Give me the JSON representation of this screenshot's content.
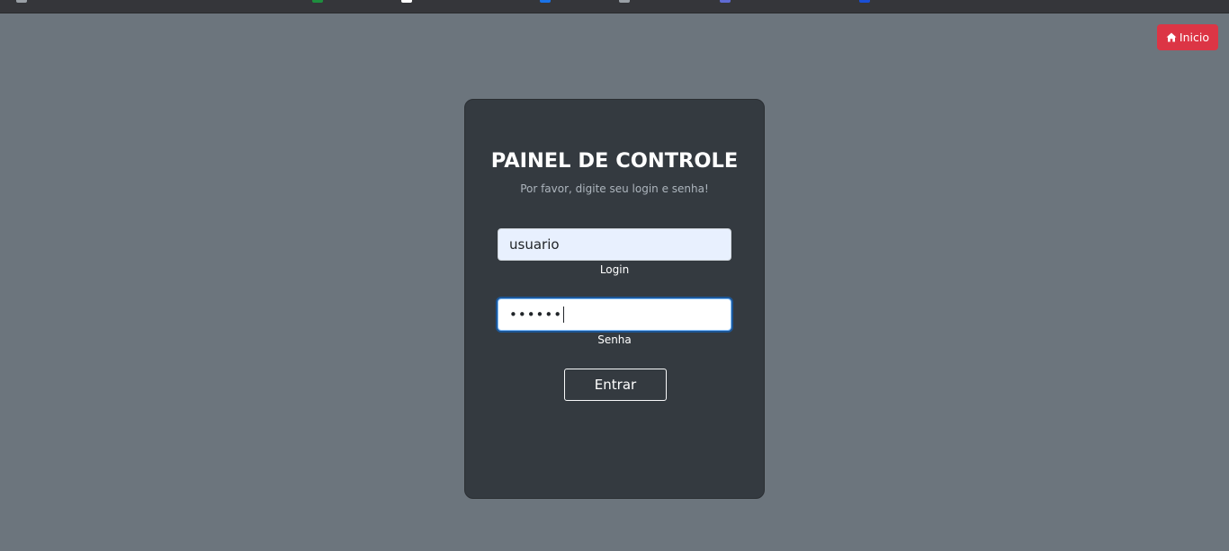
{
  "header": {
    "home_button_label": "Inicio",
    "home_icon": "house-icon"
  },
  "login_card": {
    "title": "PAINEL DE CONTROLE",
    "subtitle": "Por favor, digite seu login e senha!",
    "login_field": {
      "value": "usuario",
      "label": "Login"
    },
    "password_field": {
      "masked_value": "••••••",
      "label": "Senha"
    },
    "submit_label": "Entrar"
  },
  "colors": {
    "page_background": "#6c757d",
    "card_background": "#343a40",
    "home_button": "#dc3545",
    "autofill_background": "#e8f0fe",
    "focus_ring": "#80bdff"
  }
}
